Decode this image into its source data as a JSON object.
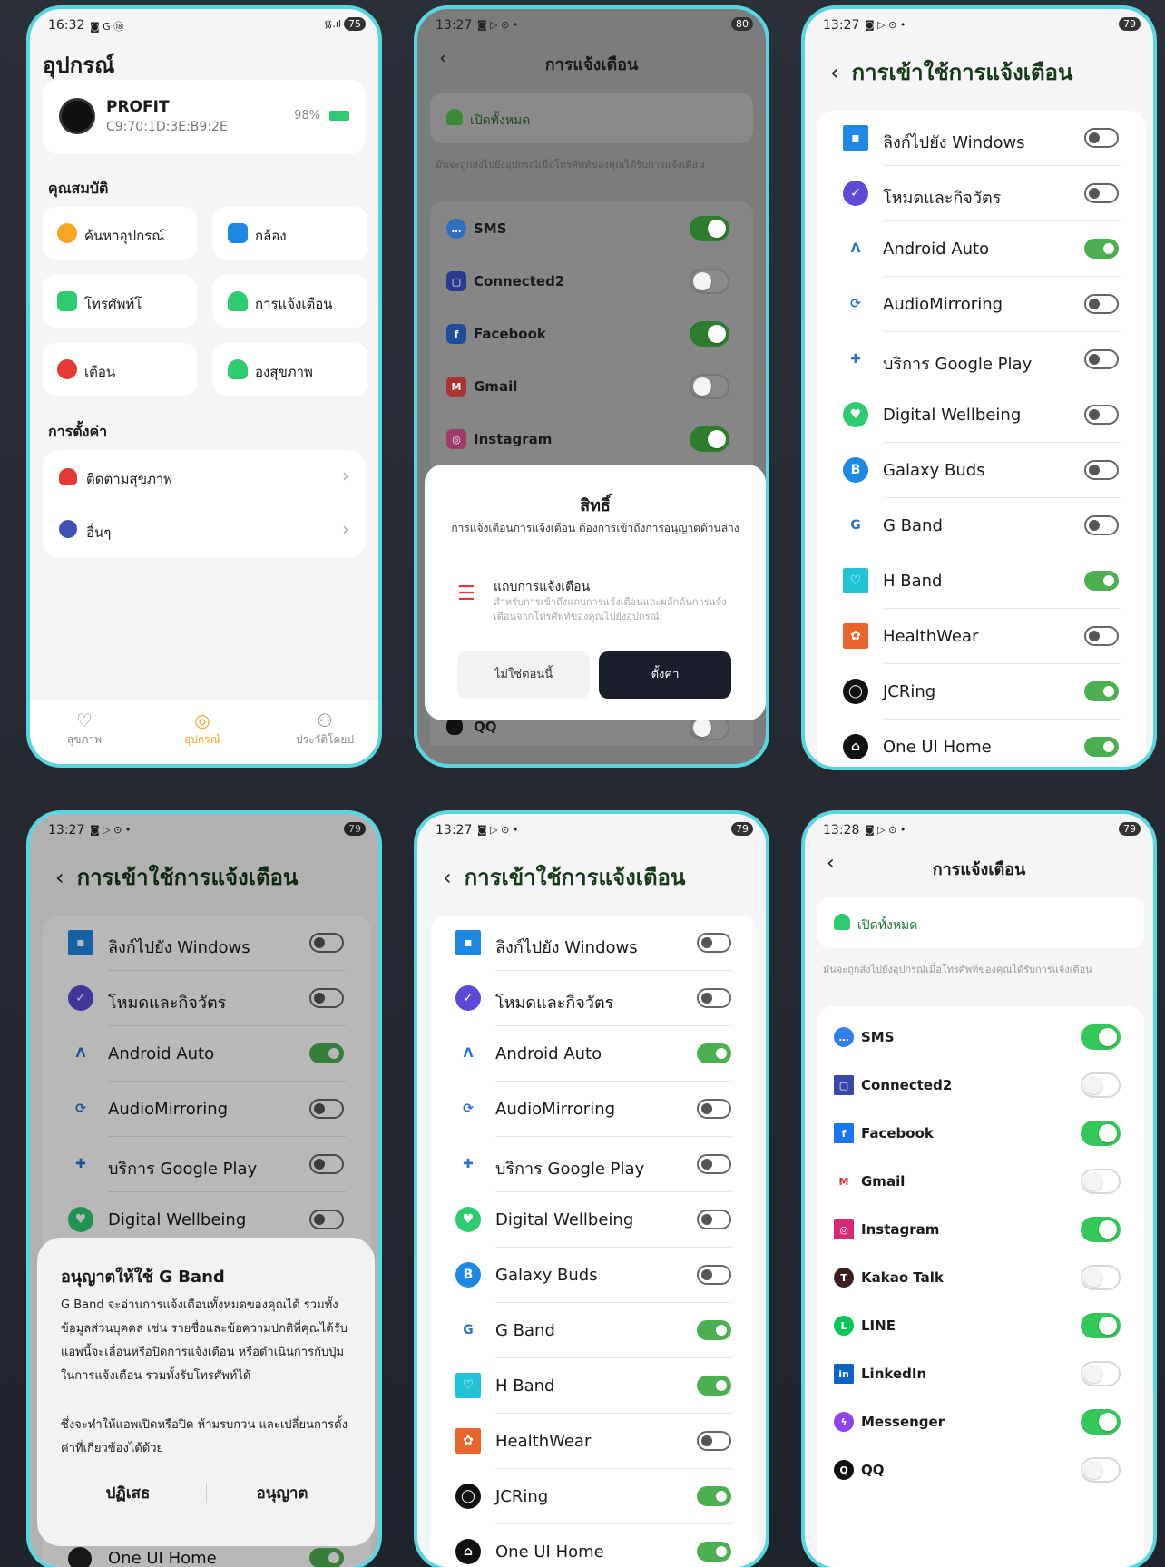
{
  "p1": {
    "time": "16:32",
    "status_icons": "◙ G ⑱",
    "signal": "᯾.ıl",
    "battery": "75",
    "title": "อุปกรณ์",
    "device_name": "PROFIT",
    "mac": "C9:70:1D:3E:B9:2E",
    "battery_pct": "98%",
    "sec_props": "คุณสมบัติ",
    "features": [
      "ค้นหาอุปกรณ์",
      "กล้อง",
      "โทรศัพท์โ",
      "การแจ้งเตือน",
      "เตือน",
      "องสุขภาพ"
    ],
    "sec_settings": "การตั้งค่า",
    "settings": [
      "ติดตามสุขภาพ",
      "อื่นๆ"
    ],
    "nav": [
      "สุขภาพ",
      "อุปกรณ์",
      "ประวัติโดยป"
    ],
    "accent": "#f5a623"
  },
  "p2": {
    "time": "13:27",
    "status_icons": "◙ ▷ ⊙ •",
    "battery": "80",
    "title": "การแจ้งเตือน",
    "open_all": "เปิดทั้งหมด",
    "hint": "มันจะถูกส่งไปยังอุปกรณ์เมื่อโทรศัพท์ของคุณได้รับการแจ้งเตือน",
    "apps": [
      {
        "name": "SMS",
        "on": true
      },
      {
        "name": "Connected2",
        "on": false
      },
      {
        "name": "Facebook",
        "on": true
      },
      {
        "name": "Gmail",
        "on": false
      },
      {
        "name": "Instagram",
        "on": true
      }
    ],
    "last_app": "QQ",
    "dialog": {
      "title": "สิทธิ์",
      "desc": "การแจ้งเตือนการแจ้งเตือน ต้องการเข้าถึงการอนุญาตด้านล่าง",
      "item_title": "แถบการแจ้งเตือน",
      "item_desc": "สำหรับการเข้าถึงแถบการแจ้งเตือนและผลักดันการแจ้งเตือนจากโทรศัพท์ของคุณไปยังอุปกรณ์",
      "cancel": "ไม่ใช่ตอนนี้",
      "ok": "ตั้งค่า"
    }
  },
  "p3": {
    "time": "13:27",
    "status_icons": "◙ ▷ ⊙ •",
    "battery": "79",
    "title": "การเข้าใช้การแจ้งเตือน",
    "apps": [
      {
        "name": "ลิงก์ไปยัง Windows",
        "on": false
      },
      {
        "name": "โหมดและกิจวัตร",
        "on": false
      },
      {
        "name": "Android Auto",
        "on": true
      },
      {
        "name": "AudioMirroring",
        "on": false
      },
      {
        "name": "บริการ Google Play",
        "on": false
      },
      {
        "name": "Digital Wellbeing",
        "on": false
      },
      {
        "name": "Galaxy Buds",
        "on": false
      },
      {
        "name": "G Band",
        "on": false
      },
      {
        "name": "H Band",
        "on": true
      },
      {
        "name": "HealthWear",
        "on": false
      },
      {
        "name": "JCRing",
        "on": true
      },
      {
        "name": "One UI Home",
        "on": true
      }
    ]
  },
  "p4": {
    "time": "13:27",
    "status_icons": "◙ ▷ ⊙ •",
    "battery": "79",
    "title": "การเข้าใช้การแจ้งเตือน",
    "apps": [
      {
        "name": "ลิงก์ไปยัง Windows",
        "on": false
      },
      {
        "name": "โหมดและกิจวัตร",
        "on": false
      },
      {
        "name": "Android Auto",
        "on": true
      },
      {
        "name": "AudioMirroring",
        "on": false
      },
      {
        "name": "บริการ Google Play",
        "on": false
      },
      {
        "name": "Digital Wellbeing",
        "on": false
      }
    ],
    "last_app": "One UI Home",
    "dialog": {
      "title": "อนุญาตให้ใช้ G Band",
      "body1": "G Band จะอ่านการแจ้งเตือนทั้งหมดของคุณได้ รวมทั้งข้อมูลส่วนบุคคล เช่น รายชื่อและข้อความปกติที่คุณได้รับ แอพนี้จะเลื่อนหรือปิดการแจ้งเตือน หรือดำเนินการกับปุ่มในการแจ้งเตือน รวมทั้งรับโทรศัพท์ได้",
      "body2": "ซึ่งจะทำให้แอพเปิดหรือปิด ห้ามรบกวน และเปลี่ยนการตั้งค่าที่เกี่ยวข้องได้ด้วย",
      "deny": "ปฏิเสธ",
      "allow": "อนุญาต"
    }
  },
  "p5": {
    "time": "13:27",
    "status_icons": "◙ ▷ ⊙ •",
    "battery": "79",
    "title": "การเข้าใช้การแจ้งเตือน",
    "apps": [
      {
        "name": "ลิงก์ไปยัง Windows",
        "on": false
      },
      {
        "name": "โหมดและกิจวัตร",
        "on": false
      },
      {
        "name": "Android Auto",
        "on": true
      },
      {
        "name": "AudioMirroring",
        "on": false
      },
      {
        "name": "บริการ Google Play",
        "on": false
      },
      {
        "name": "Digital Wellbeing",
        "on": false
      },
      {
        "name": "Galaxy Buds",
        "on": false
      },
      {
        "name": "G Band",
        "on": true
      },
      {
        "name": "H Band",
        "on": true
      },
      {
        "name": "HealthWear",
        "on": false
      },
      {
        "name": "JCRing",
        "on": true
      },
      {
        "name": "One UI Home",
        "on": true
      }
    ]
  },
  "p6": {
    "time": "13:28",
    "status_icons": "◙ ▷ ⊙ •",
    "battery": "79",
    "title": "การแจ้งเตือน",
    "open_all": "เปิดทั้งหมด",
    "hint": "มันจะถูกส่งไปยังอุปกรณ์เมื่อโทรศัพท์ของคุณได้รับการแจ้งเตือน",
    "apps": [
      {
        "name": "SMS",
        "on": true
      },
      {
        "name": "Connected2",
        "on": false
      },
      {
        "name": "Facebook",
        "on": true
      },
      {
        "name": "Gmail",
        "on": false
      },
      {
        "name": "Instagram",
        "on": true
      },
      {
        "name": "Kakao Talk",
        "on": false
      },
      {
        "name": "LINE",
        "on": true
      },
      {
        "name": "LinkedIn",
        "on": false
      },
      {
        "name": "Messenger",
        "on": true
      },
      {
        "name": "QQ",
        "on": false
      }
    ]
  },
  "icons": {
    "back": "chevron-left-icon",
    "chevron": "chevron-right-icon"
  }
}
